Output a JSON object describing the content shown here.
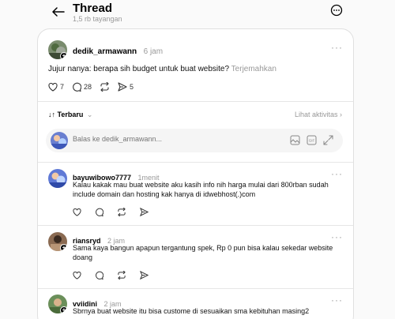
{
  "header": {
    "title": "Thread",
    "views": "1,5 rb tayangan"
  },
  "post": {
    "username": "dedik_armawann",
    "time": "6 jam",
    "text": "Jujur nanya: berapa sih budget untuk buat website?",
    "translate": "Terjemahkan",
    "likes": "7",
    "comments": "28",
    "shares": "5"
  },
  "sort": {
    "label": "Terbaru",
    "activity": "Lihat aktivitas"
  },
  "reply_box": {
    "placeholder": "Balas ke dedik_armawann..."
  },
  "replies": [
    {
      "username": "bayuwibowo7777",
      "time": "1menit",
      "text": "Kalau kakak mau buat website aku kasih info nih harga mulai dari 800rban sudah include domain dan hosting kak hanya di idwebhost(.)com"
    },
    {
      "username": "riansryd",
      "time": "2 jam",
      "text": "Sama kaya bangun apapun tergantung spek, Rp 0 pun bisa kalau sekedar website doang"
    },
    {
      "username": "vviidini",
      "time": "2 jam",
      "text": "Sbrnya buat website itu bisa custome di sesuaikan sma kebituhan masing2"
    }
  ]
}
